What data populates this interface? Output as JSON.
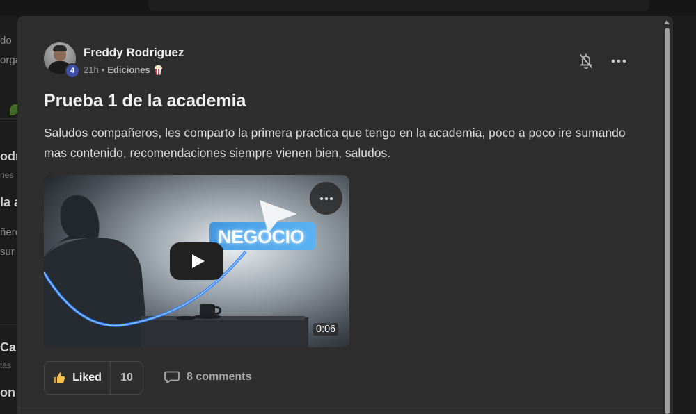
{
  "background": {
    "fragments": [
      "do",
      "orga",
      "odr",
      "nes",
      "la a",
      "ñero",
      "sur",
      "Can",
      "tas",
      "on"
    ]
  },
  "post": {
    "author": "Freddy Rodriguez",
    "level": "4",
    "time": "21h",
    "separator": "•",
    "category": "Ediciones",
    "title": "Prueba 1 de la academia",
    "body": "Saludos compañeros, les comparto la primera practica que tengo en la academia, poco a poco ire sumando mas contenido, recomendaciones siempre vienen bien, saludos.",
    "video": {
      "overlay_text": "NEGOCIO",
      "duration": "0:06"
    },
    "likes": {
      "label": "Liked",
      "count": "10"
    },
    "comments": {
      "label": "8 comments"
    }
  },
  "icons": {
    "bell": "bell-off-icon",
    "more": "more-horizontal-icon",
    "like": "thumbs-up-icon",
    "comment": "comment-icon",
    "play": "play-icon",
    "category_emoji": "popcorn-icon"
  },
  "colors": {
    "modal_bg": "#2e2e2e",
    "page_bg": "#161616",
    "badge": "#3f4fa8",
    "like_icon": "#f2c14e",
    "video_accent": "#2f7fff"
  }
}
